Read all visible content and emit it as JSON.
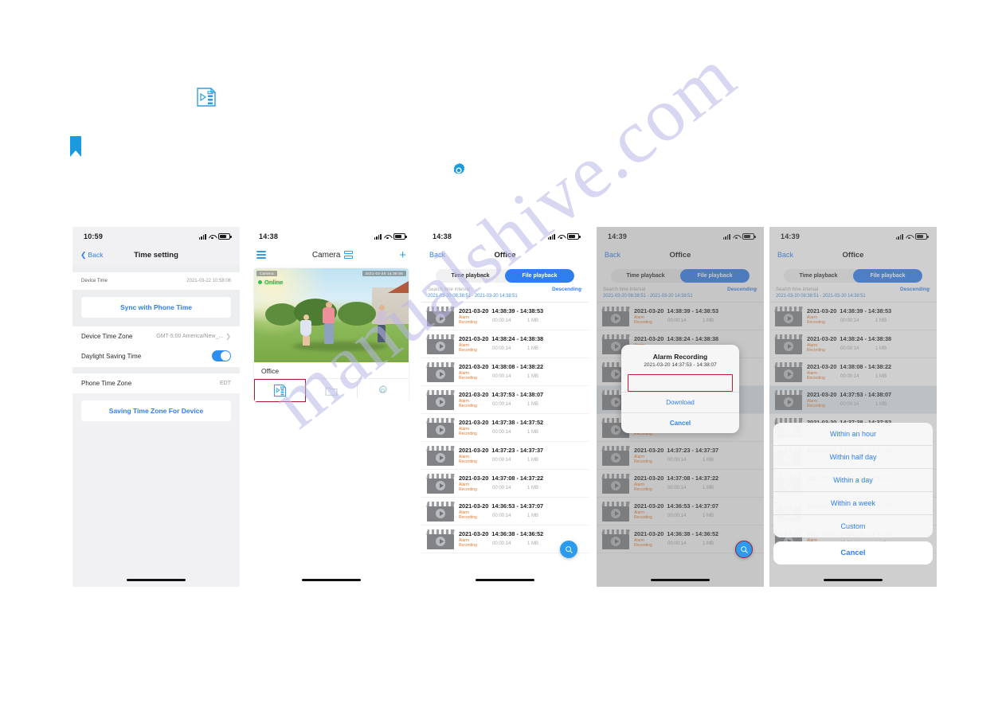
{
  "watermark": "manualshive.com",
  "doc_icons": {
    "playlist": "playback-list-icon",
    "bookmark": "bookmark-icon",
    "gear": "gear-icon"
  },
  "phone1": {
    "status": {
      "time": "10:59"
    },
    "nav": {
      "back": "Back",
      "title": "Time setting"
    },
    "device_time": {
      "label": "Device Time",
      "value": "2021-03-22 10:58:06"
    },
    "sync_button": "Sync with Phone Time",
    "device_zone": {
      "label": "Device Time Zone",
      "value": "GMT-5:00 America/New_..."
    },
    "dst": {
      "label": "Daylight Saving Time",
      "state": "on"
    },
    "phone_zone": {
      "label": "Phone Time Zone",
      "value": "EDT"
    },
    "save_button": "Saving Time Zone For Device"
  },
  "phone2": {
    "status": {
      "time": "14:38"
    },
    "nav": {
      "title": "Camera"
    },
    "card": {
      "overlay_left": "Camera",
      "overlay_right": "2021-03-20 14:38:56",
      "online": "Online",
      "name": "Office"
    },
    "tools": [
      "playback-list-icon",
      "folder-icon",
      "gear-icon"
    ]
  },
  "list_screen": {
    "nav": {
      "back": "Back",
      "title": "Office"
    },
    "tabs": [
      {
        "label": "Time playback",
        "active": false
      },
      {
        "label": "File playback",
        "active": true
      }
    ],
    "search": {
      "placeholder": "Search time interval",
      "range": "2021-03-20 08:38:51 - 2021-03-20 14:38:51",
      "sort": "Descending"
    },
    "recordings": [
      {
        "date": "2021-03-20",
        "range": "14:38:39 - 14:38:53",
        "type": "Alarm Recording",
        "duration": "00:00:14",
        "size": "1 MB"
      },
      {
        "date": "2021-03-20",
        "range": "14:38:24 - 14:38:38",
        "type": "Alarm Recording",
        "duration": "00:00:14",
        "size": "1 MB"
      },
      {
        "date": "2021-03-20",
        "range": "14:38:08 - 14:38:22",
        "type": "Alarm Recording",
        "duration": "00:00:14",
        "size": "1 MB"
      },
      {
        "date": "2021-03-20",
        "range": "14:37:53 - 14:38:07",
        "type": "Alarm Recording",
        "duration": "00:00:14",
        "size": "1 MB"
      },
      {
        "date": "2021-03-20",
        "range": "14:37:38 - 14:37:52",
        "type": "Alarm Recording",
        "duration": "00:00:14",
        "size": "1 MB"
      },
      {
        "date": "2021-03-20",
        "range": "14:37:23 - 14:37:37",
        "type": "Alarm Recording",
        "duration": "00:00:14",
        "size": "1 MB"
      },
      {
        "date": "2021-03-20",
        "range": "14:37:08 - 14:37:22",
        "type": "Alarm Recording",
        "duration": "00:00:14",
        "size": "1 MB"
      },
      {
        "date": "2021-03-20",
        "range": "14:36:53 - 14:37:07",
        "type": "Alarm Recording",
        "duration": "00:00:14",
        "size": "1 MB"
      },
      {
        "date": "2021-03-20",
        "range": "14:36:38 - 14:36:52",
        "type": "Alarm Recording",
        "duration": "00:00:14",
        "size": "1 MB"
      }
    ],
    "fab": "search-icon"
  },
  "phone3": {
    "status": {
      "time": "14:38"
    }
  },
  "phone4": {
    "status": {
      "time": "14:39"
    },
    "dialog": {
      "title": "Alarm Recording",
      "subtitle": "2021-03-20 14:37:53 - 14:38:07",
      "download": "Download",
      "cancel": "Cancel"
    }
  },
  "phone5": {
    "status": {
      "time": "14:39"
    },
    "sheet": {
      "options": [
        "Within an hour",
        "Within half day",
        "Within a day",
        "Within a week",
        "Custom"
      ],
      "cancel": "Cancel"
    }
  },
  "colors": {
    "accent_blue": "#2f7ef0",
    "icon_blue": "#2f9fe0",
    "highlight_red": "#a81c33",
    "alarm_orange": "#e8782b",
    "online_green": "#2fbf4e",
    "watermark_purple": "#b9b7e8"
  }
}
